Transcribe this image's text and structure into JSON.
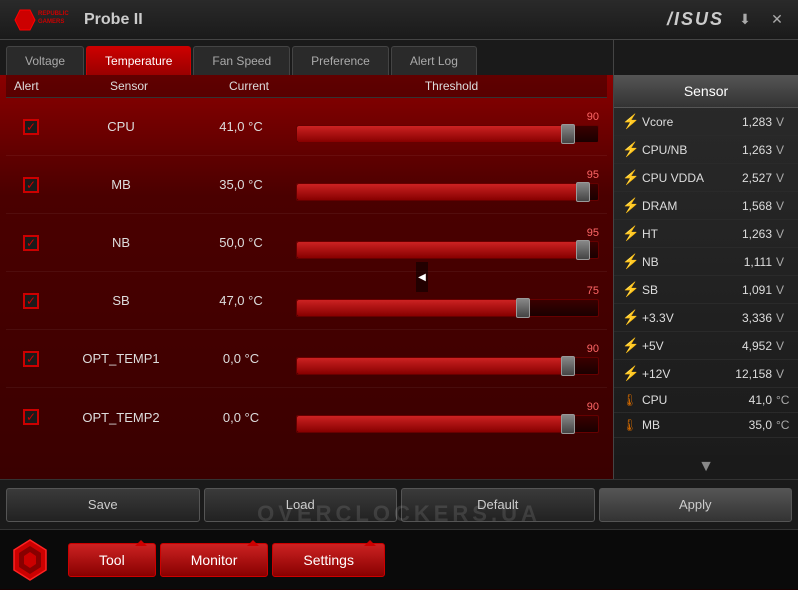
{
  "titlebar": {
    "app_name": "Probe II",
    "asus_label": "/ISUS",
    "download_icon": "⬇",
    "close_icon": "✕"
  },
  "tabs": [
    {
      "id": "voltage",
      "label": "Voltage",
      "active": false
    },
    {
      "id": "temperature",
      "label": "Temperature",
      "active": true
    },
    {
      "id": "fan_speed",
      "label": "Fan Speed",
      "active": false
    },
    {
      "id": "preference",
      "label": "Preference",
      "active": false
    },
    {
      "id": "alert_log",
      "label": "Alert Log",
      "active": false
    }
  ],
  "table_headers": {
    "alert": "Alert",
    "sensor": "Sensor",
    "current": "Current",
    "threshold": "Threshold"
  },
  "sensor_rows": [
    {
      "name": "CPU",
      "current": "41,0 °C",
      "threshold": 90.0,
      "threshold_pct": 90,
      "checked": true
    },
    {
      "name": "MB",
      "current": "35,0 °C",
      "threshold": 95.0,
      "threshold_pct": 95,
      "checked": true
    },
    {
      "name": "NB",
      "current": "50,0 °C",
      "threshold": 95.0,
      "threshold_pct": 95,
      "checked": true
    },
    {
      "name": "SB",
      "current": "47,0 °C",
      "threshold": 75.0,
      "threshold_pct": 75,
      "checked": true
    },
    {
      "name": "OPT_TEMP1",
      "current": "0,0 °C",
      "threshold": 90.0,
      "threshold_pct": 90,
      "checked": true
    },
    {
      "name": "OPT_TEMP2",
      "current": "0,0 °C",
      "threshold": 90.0,
      "threshold_pct": 90,
      "checked": true
    }
  ],
  "bottom_buttons": {
    "save": "Save",
    "load": "Load",
    "default": "Default",
    "apply": "Apply"
  },
  "right_panel": {
    "title": "Sensor",
    "items": [
      {
        "name": "Vcore",
        "value": "1,283",
        "unit": "V",
        "icon": "⚡",
        "type": "voltage"
      },
      {
        "name": "CPU/NB",
        "value": "1,263",
        "unit": "V",
        "icon": "⚡",
        "type": "voltage"
      },
      {
        "name": "CPU VDDA",
        "value": "2,527",
        "unit": "V",
        "icon": "⚡",
        "type": "voltage"
      },
      {
        "name": "DRAM",
        "value": "1,568",
        "unit": "V",
        "icon": "⚡",
        "type": "voltage"
      },
      {
        "name": "HT",
        "value": "1,263",
        "unit": "V",
        "icon": "⚡",
        "type": "voltage"
      },
      {
        "name": "NB",
        "value": "1,111",
        "unit": "V",
        "icon": "⚡",
        "type": "voltage"
      },
      {
        "name": "SB",
        "value": "1,091",
        "unit": "V",
        "icon": "⚡",
        "type": "voltage"
      },
      {
        "+3.3V": "+3.3V",
        "name": "+3.3V",
        "value": "3,336",
        "unit": "V",
        "icon": "⚡",
        "type": "voltage"
      },
      {
        "name": "+5V",
        "value": "4,952",
        "unit": "V",
        "icon": "⚡",
        "type": "voltage"
      },
      {
        "name": "+12V",
        "value": "12,158",
        "unit": "V",
        "icon": "⚡",
        "type": "voltage"
      },
      {
        "name": "CPU",
        "value": "41,0",
        "unit": "°C",
        "icon": "🌡",
        "type": "temp"
      },
      {
        "name": "MB",
        "value": "35,0",
        "unit": "°C",
        "icon": "🌡",
        "type": "temp"
      }
    ]
  },
  "footer": {
    "tool_label": "Tool",
    "monitor_label": "Monitor",
    "settings_label": "Settings"
  },
  "watermark": "OVERCLOCKERS.UA"
}
